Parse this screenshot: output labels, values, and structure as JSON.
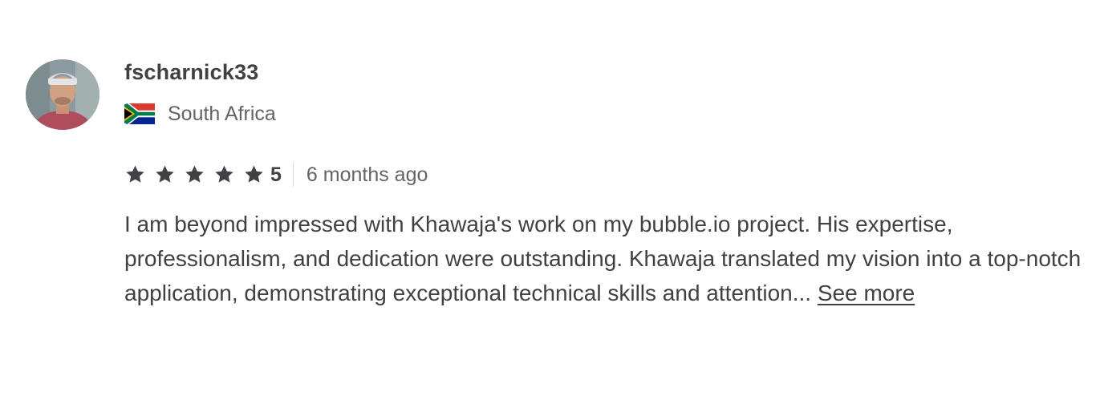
{
  "review": {
    "username": "fscharnick33",
    "country": "South Africa",
    "flag_icon": "south-africa-flag-icon",
    "rating": {
      "stars": 5,
      "value_label": "5",
      "star_color": "#404145"
    },
    "time_ago": "6 months ago",
    "text": "I am beyond impressed with Khawaja's work on my bubble.io project. His expertise, professionalism, and dedication were outstanding. Khawaja translated my vision into a top-notch application, demonstrating exceptional technical skills and attention...",
    "see_more_label": "See more"
  },
  "colors": {
    "text_primary": "#404145",
    "text_secondary": "#62646a",
    "divider": "#dadbdd"
  }
}
